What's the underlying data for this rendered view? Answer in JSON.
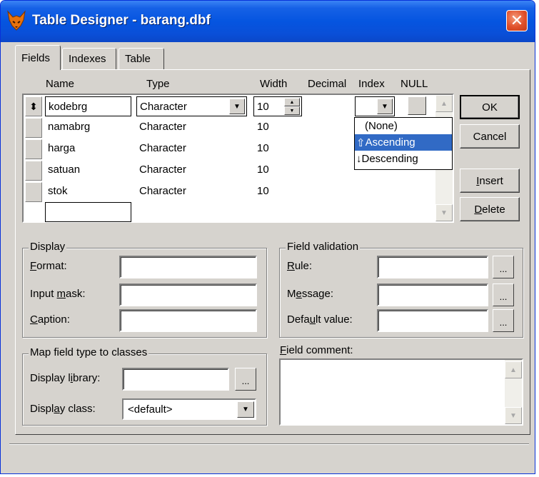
{
  "window": {
    "title": "Table Designer - barang.dbf",
    "close_glyph": "✕",
    "icon": "foxpro-fox-icon"
  },
  "tabs": [
    {
      "label": "Fields",
      "active": true
    },
    {
      "label": "Indexes",
      "active": false
    },
    {
      "label": "Table",
      "active": false
    }
  ],
  "grid": {
    "columns": [
      "Name",
      "Type",
      "Width",
      "Decimal",
      "Index",
      "NULL"
    ],
    "current_row": {
      "name": "kodebrg",
      "type": "Character",
      "width": "10"
    },
    "rows": [
      {
        "name": "namabrg",
        "type": "Character",
        "width": "10"
      },
      {
        "name": "harga",
        "type": "Character",
        "width": "10"
      },
      {
        "name": "satuan",
        "type": "Character",
        "width": "10"
      },
      {
        "name": "stok",
        "type": "Character",
        "width": "10"
      }
    ],
    "new_row_name": "",
    "row_selector_glyph": "⬍"
  },
  "index_dropdown": {
    "options": [
      "(None)",
      "Ascending",
      "Descending"
    ],
    "selected": "Ascending",
    "asc_glyph": "⇧",
    "desc_glyph": "↓"
  },
  "buttons": {
    "ok": "OK",
    "cancel": "Cancel",
    "insert_first": "I",
    "insert_rest": "nsert",
    "delete_first": "D",
    "delete_rest": "elete"
  },
  "display": {
    "title": "Display",
    "format_u": "F",
    "format_rest": "ormat:",
    "input_mask_pre": "Input ",
    "input_mask_u": "m",
    "input_mask_rest": "ask:",
    "caption_u": "C",
    "caption_rest": "aption:",
    "format_value": "",
    "input_mask_value": "",
    "caption_value": ""
  },
  "validation": {
    "title": "Field validation",
    "rule_u": "R",
    "rule_rest": "ule:",
    "message_pre": "M",
    "message_u": "e",
    "message_rest": "ssage:",
    "default_pre": "Defa",
    "default_u": "u",
    "default_rest": "lt value:",
    "dots": "..."
  },
  "map_classes": {
    "title": "Map field type to classes",
    "library_pre": "Display l",
    "library_u": "i",
    "library_rest": "brary:",
    "class_pre": "Displ",
    "class_u": "a",
    "class_rest": "y class:",
    "library_value": "",
    "class_value": "<default>"
  },
  "comment": {
    "title_u": "F",
    "title_rest": "ield comment:",
    "value": ""
  },
  "colors": {
    "title_bar": "#0555e0",
    "selection": "#316ac5",
    "face": "#d6d3ce"
  }
}
